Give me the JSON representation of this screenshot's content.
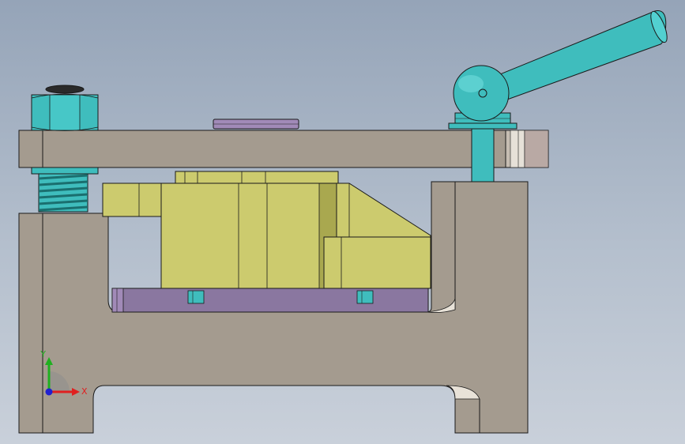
{
  "viewport": {
    "background_top": "#95a4b8",
    "background_bottom": "#c9d0da"
  },
  "colors": {
    "body_gray": "#a49b8f",
    "edge": "#1a1a1a",
    "yellow": "#cccb6e",
    "yellow_dark": "#a9a84f",
    "purple": "#8a77a0",
    "purple_light": "#a18ab8",
    "teal": "#3fbdbd",
    "teal_dark": "#1f8f8f",
    "axis_x": "#e02020",
    "axis_y": "#20b020",
    "axis_z": "#2020d0"
  },
  "parts": {
    "base": "fixture-base",
    "clamp_plate": "clamp-plate",
    "workpiece": "workpiece",
    "locator_plate": "locator-plate",
    "hex_nut": "hex-nut",
    "threaded_stud": "threaded-stud",
    "cam_handle": "cam-lever-handle",
    "pressure_pad": "pressure-pad"
  },
  "triad": {
    "x_label": "X",
    "y_label": "Y"
  }
}
